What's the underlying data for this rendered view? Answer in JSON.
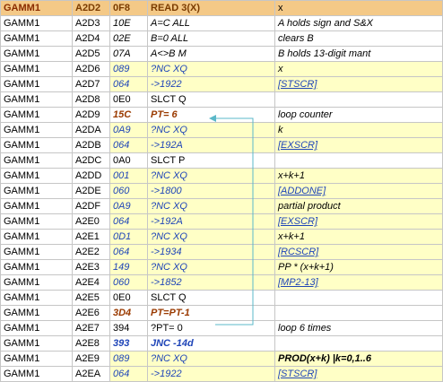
{
  "header": {
    "col1": "GAMM1",
    "col2": "A2D2",
    "col3": "0F8",
    "col4": "READ 3(X)",
    "col5": "x"
  },
  "rows": [
    {
      "mod": "GAMM1",
      "adr": "A2D3",
      "hex": "10E",
      "op": "A=C ALL",
      "cm": "A holds sign and S&X",
      "hex_style": "ital",
      "op_style": "ital",
      "cm_style": "ital",
      "hl": false
    },
    {
      "mod": "GAMM1",
      "adr": "A2D4",
      "hex": "02E",
      "op": "B=0  ALL",
      "cm": "clears B",
      "hex_style": "ital",
      "op_style": "ital",
      "cm_style": "ital",
      "hl": false
    },
    {
      "mod": "GAMM1",
      "adr": "A2D5",
      "hex": "07A",
      "op": "A<>B  M",
      "cm": "B holds 13-digit mant",
      "hex_style": "ital",
      "op_style": "ital",
      "cm_style": "ital",
      "hl": false
    },
    {
      "mod": "GAMM1",
      "adr": "A2D6",
      "hex": "089",
      "op": "?NC XQ",
      "cm": "x",
      "hex_style": "blue",
      "op_style": "blue",
      "cm_style": "ital",
      "hl": true
    },
    {
      "mod": "GAMM1",
      "adr": "A2D7",
      "hex": "064",
      "op": "->1922",
      "cm": "[STSCR]",
      "hex_style": "blue",
      "op_style": "blue",
      "cm_style": "blue uline",
      "hl": true
    },
    {
      "mod": "GAMM1",
      "adr": "A2D8",
      "hex": "0E0",
      "op": "SLCT Q",
      "cm": "",
      "hex_style": "",
      "op_style": "",
      "cm_style": "",
      "hl": false
    },
    {
      "mod": "GAMM1",
      "adr": "A2D9",
      "hex": "15C",
      "op": "PT= 6",
      "cm": "loop counter",
      "hex_style": "brown",
      "op_style": "brown",
      "cm_style": "ital",
      "hl": false
    },
    {
      "mod": "GAMM1",
      "adr": "A2DA",
      "hex": "0A9",
      "op": "?NC XQ",
      "cm": "k",
      "hex_style": "blue",
      "op_style": "blue",
      "cm_style": "ital",
      "hl": true
    },
    {
      "mod": "GAMM1",
      "adr": "A2DB",
      "hex": "064",
      "op": "->192A",
      "cm": "[EXSCR]",
      "hex_style": "blue",
      "op_style": "blue",
      "cm_style": "blue uline",
      "hl": true
    },
    {
      "mod": "GAMM1",
      "adr": "A2DC",
      "hex": "0A0",
      "op": "SLCT P",
      "cm": "",
      "hex_style": "",
      "op_style": "",
      "cm_style": "",
      "hl": false
    },
    {
      "mod": "GAMM1",
      "adr": "A2DD",
      "hex": "001",
      "op": "?NC XQ",
      "cm": "x+k+1",
      "hex_style": "blue",
      "op_style": "blue",
      "cm_style": "ital",
      "hl": true
    },
    {
      "mod": "GAMM1",
      "adr": "A2DE",
      "hex": "060",
      "op": "->1800",
      "cm": "[ADDONE]",
      "hex_style": "blue",
      "op_style": "blue",
      "cm_style": "blue uline",
      "hl": true
    },
    {
      "mod": "GAMM1",
      "adr": "A2DF",
      "hex": "0A9",
      "op": "?NC XQ",
      "cm": "partial product",
      "hex_style": "blue",
      "op_style": "blue",
      "cm_style": "ital",
      "hl": true
    },
    {
      "mod": "GAMM1",
      "adr": "A2E0",
      "hex": "064",
      "op": "->192A",
      "cm": "[EXSCR]",
      "hex_style": "blue",
      "op_style": "blue",
      "cm_style": "blue uline",
      "hl": true
    },
    {
      "mod": "GAMM1",
      "adr": "A2E1",
      "hex": "0D1",
      "op": "?NC XQ",
      "cm": "x+k+1",
      "hex_style": "blue",
      "op_style": "blue",
      "cm_style": "ital",
      "hl": true
    },
    {
      "mod": "GAMM1",
      "adr": "A2E2",
      "hex": "064",
      "op": "->1934",
      "cm": "[RCSCR]",
      "hex_style": "blue",
      "op_style": "blue",
      "cm_style": "blue uline",
      "hl": true
    },
    {
      "mod": "GAMM1",
      "adr": "A2E3",
      "hex": "149",
      "op": "?NC XQ",
      "cm": "PP * (x+k+1)",
      "hex_style": "blue",
      "op_style": "blue",
      "cm_style": "ital",
      "hl": true
    },
    {
      "mod": "GAMM1",
      "adr": "A2E4",
      "hex": "060",
      "op": "->1852",
      "cm": "[MP2-13]",
      "hex_style": "blue",
      "op_style": "blue",
      "cm_style": "blue uline",
      "hl": true
    },
    {
      "mod": "GAMM1",
      "adr": "A2E5",
      "hex": "0E0",
      "op": "SLCT Q",
      "cm": "",
      "hex_style": "",
      "op_style": "",
      "cm_style": "",
      "hl": false
    },
    {
      "mod": "GAMM1",
      "adr": "A2E6",
      "hex": "3D4",
      "op": "PT=PT-1",
      "cm": "",
      "hex_style": "brown",
      "op_style": "brown",
      "cm_style": "",
      "hl": false
    },
    {
      "mod": "GAMM1",
      "adr": "A2E7",
      "hex": "394",
      "op": "?PT= 0",
      "cm": "loop 6 times",
      "hex_style": "",
      "op_style": "",
      "cm_style": "ital",
      "hl": false
    },
    {
      "mod": "GAMM1",
      "adr": "A2E8",
      "hex": "393",
      "op": "JNC -14d",
      "cm": "",
      "hex_style": "blue bold",
      "op_style": "blue bold",
      "cm_style": "",
      "hl": false
    },
    {
      "mod": "GAMM1",
      "adr": "A2E9",
      "hex": "089",
      "op": "?NC XQ",
      "cm": "PROD(x+k) |k=0,1..6",
      "hex_style": "blue",
      "op_style": "blue",
      "cm_style": "ital bold",
      "hl": true
    },
    {
      "mod": "GAMM1",
      "adr": "A2EA",
      "hex": "064",
      "op": "->1922",
      "cm": "[STSCR]",
      "hex_style": "blue",
      "op_style": "blue",
      "cm_style": "blue uline",
      "hl": true
    }
  ],
  "arrow_color": "#5bb8c9",
  "highlight_color": "#ffffc6",
  "header_color": "#f4c987"
}
